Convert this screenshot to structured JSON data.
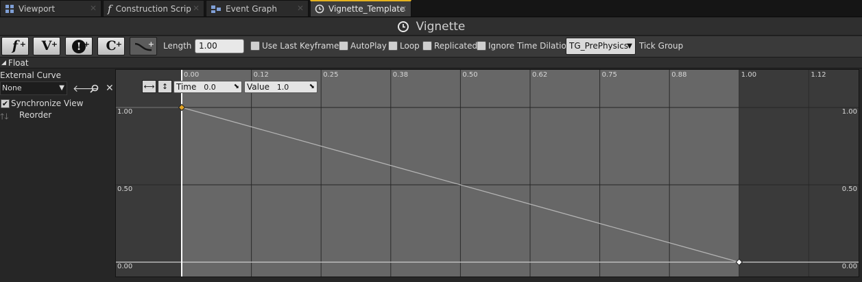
{
  "tabs": [
    {
      "label": "Viewport",
      "icon": "viewport-icon",
      "active": false
    },
    {
      "label": "Construction Scrip",
      "icon": "function-icon",
      "active": false
    },
    {
      "label": "Event Graph",
      "icon": "event-graph-icon",
      "active": false
    },
    {
      "label": "Vignette_Template",
      "icon": "clock-icon",
      "active": true
    }
  ],
  "title": "Vignette",
  "toolbar": {
    "add_float_glyph": "f",
    "add_vector_glyph": "V",
    "add_event_glyph": "!",
    "add_color_glyph": "C",
    "plus": "+",
    "length_label": "Length",
    "length_value": "1.00",
    "use_last_keyframe": "Use Last Keyframe?",
    "autoplay": "AutoPlay",
    "loop": "Loop",
    "replicated": "Replicated",
    "ignore_time_dilation": "Ignore Time Dilation",
    "tick_group_value": "TG_PrePhysics",
    "tick_group_label": "Tick Group"
  },
  "section": {
    "label": "Float"
  },
  "left_panel": {
    "external_curve_label": "External Curve",
    "curve_value": "None",
    "synchronize_view": "Synchronize View",
    "reorder": "Reorder"
  },
  "graph": {
    "time_label": "Time",
    "time_value": "0.0",
    "value_label": "Value",
    "value_value": "1.0",
    "x_ticks": [
      "0.00",
      "0.12",
      "0.25",
      "0.38",
      "0.50",
      "0.62",
      "0.75",
      "0.88",
      "1.00",
      "1.12"
    ],
    "y_ticks": [
      "1.00",
      "0.50",
      "0.00"
    ],
    "keys": [
      {
        "time": 0.0,
        "value": 1.0
      },
      {
        "time": 1.0,
        "value": 0.0
      }
    ],
    "timeline_length": 1.0,
    "colors": {
      "active_region": "#676767",
      "inactive_region": "#3a3a3a",
      "curve": "#b4b4b4",
      "key_selected": "#e2a325",
      "key": "#ffffff"
    }
  }
}
